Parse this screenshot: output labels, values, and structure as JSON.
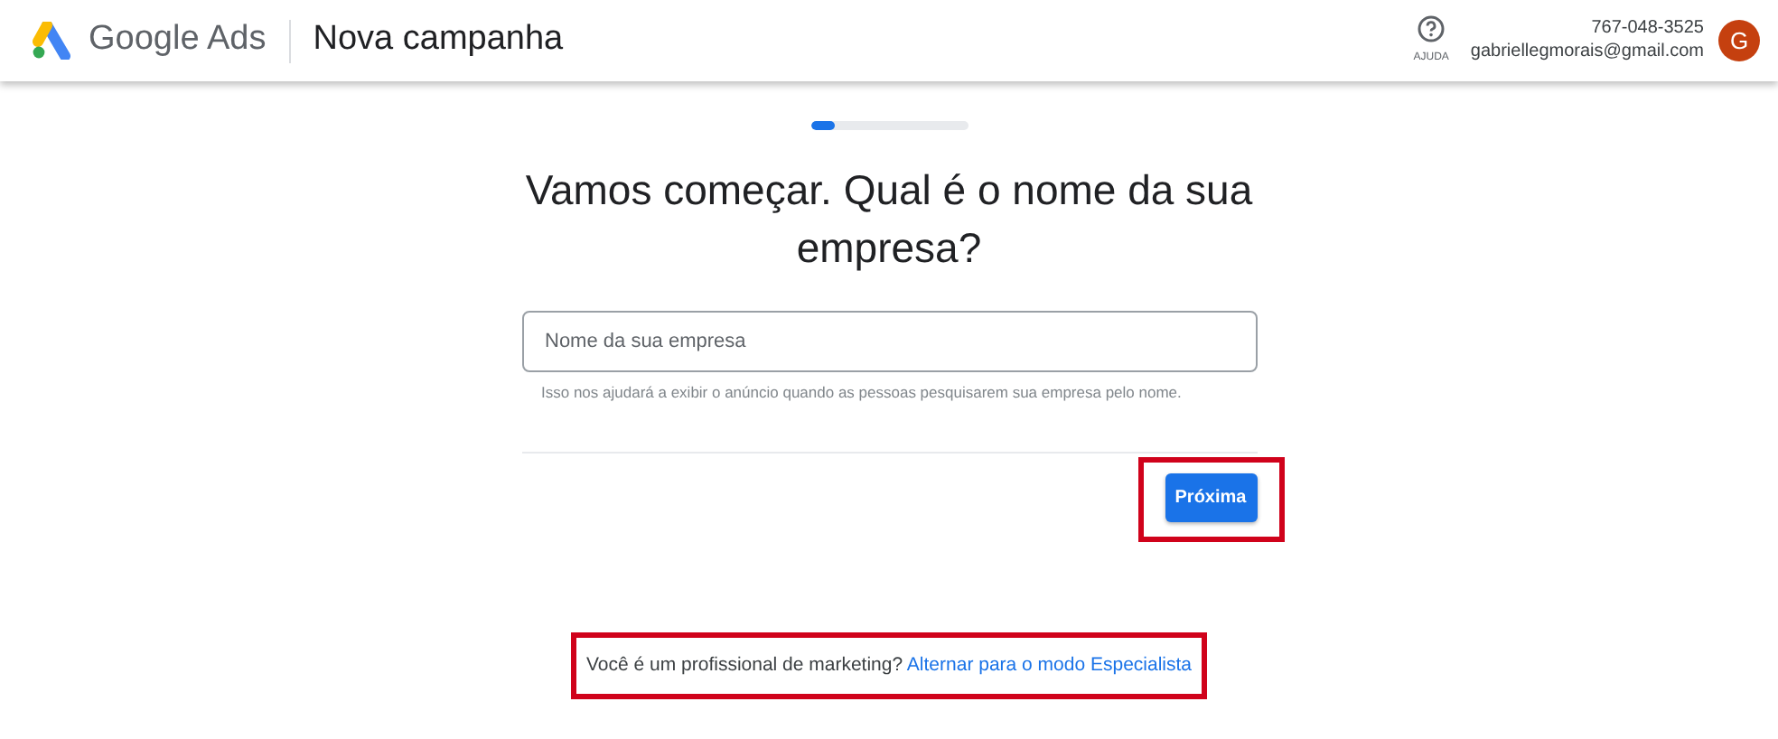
{
  "header": {
    "brand": "Google Ads",
    "page_title": "Nova campanha",
    "help_label": "AJUDA",
    "account_id": "767-048-3525",
    "email": "gabriellegmorais@gmail.com",
    "avatar_letter": "G"
  },
  "progress": {
    "level": 0.15
  },
  "question": "Vamos começar. Qual é o nome da sua empresa?",
  "field": {
    "placeholder": "Nome da sua empresa",
    "hint": "Isso nos ajudará a exibir o anúncio quando as pessoas pesquisarem sua empresa pelo nome."
  },
  "next_button": {
    "label": "Próxima",
    "highlighted": true
  },
  "footer": {
    "text": "Você é um profissional de marketing?",
    "link": "Alternar para o modo Especialista",
    "highlighted": true
  }
}
